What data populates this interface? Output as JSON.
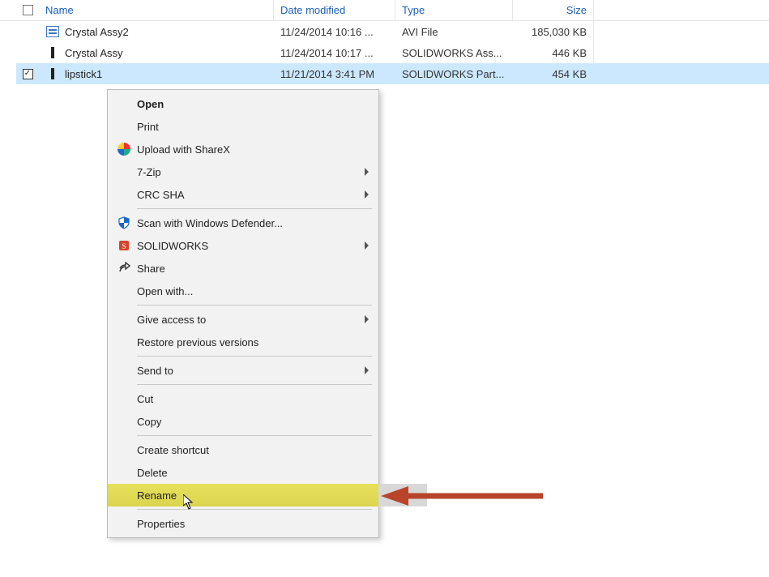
{
  "columns": {
    "name": "Name",
    "date": "Date modified",
    "type": "Type",
    "size": "Size"
  },
  "files": [
    {
      "name": "Crystal  Assy2",
      "date": "11/24/2014 10:16 ...",
      "type": "AVI File",
      "size": "185,030 KB",
      "icon": "avi",
      "selected": false,
      "checked": false
    },
    {
      "name": "Crystal Assy",
      "date": "11/24/2014 10:17 ...",
      "type": "SOLIDWORKS Ass...",
      "size": "446 KB",
      "icon": "sw",
      "selected": false,
      "checked": false
    },
    {
      "name": "lipstick1",
      "date": "11/21/2014 3:41 PM",
      "type": "SOLIDWORKS Part...",
      "size": "454 KB",
      "icon": "sw",
      "selected": true,
      "checked": true
    }
  ],
  "menu": {
    "groups": [
      [
        {
          "label": "Open",
          "bold": true
        },
        {
          "label": "Print"
        },
        {
          "label": "Upload with ShareX",
          "icon": "sharex"
        },
        {
          "label": "7-Zip",
          "submenu": true
        },
        {
          "label": "CRC SHA",
          "submenu": true
        }
      ],
      [
        {
          "label": "Scan with Windows Defender...",
          "icon": "defender"
        },
        {
          "label": "SOLIDWORKS",
          "icon": "solidworks",
          "submenu": true
        },
        {
          "label": "Share",
          "icon": "share"
        },
        {
          "label": "Open with..."
        }
      ],
      [
        {
          "label": "Give access to",
          "submenu": true
        },
        {
          "label": "Restore previous versions"
        }
      ],
      [
        {
          "label": "Send to",
          "submenu": true
        }
      ],
      [
        {
          "label": "Cut"
        },
        {
          "label": "Copy"
        }
      ],
      [
        {
          "label": "Create shortcut"
        },
        {
          "label": "Delete"
        },
        {
          "label": "Rename",
          "highlighted": true
        }
      ],
      [
        {
          "label": "Properties"
        }
      ]
    ]
  },
  "annotation": {
    "target": "Rename"
  }
}
